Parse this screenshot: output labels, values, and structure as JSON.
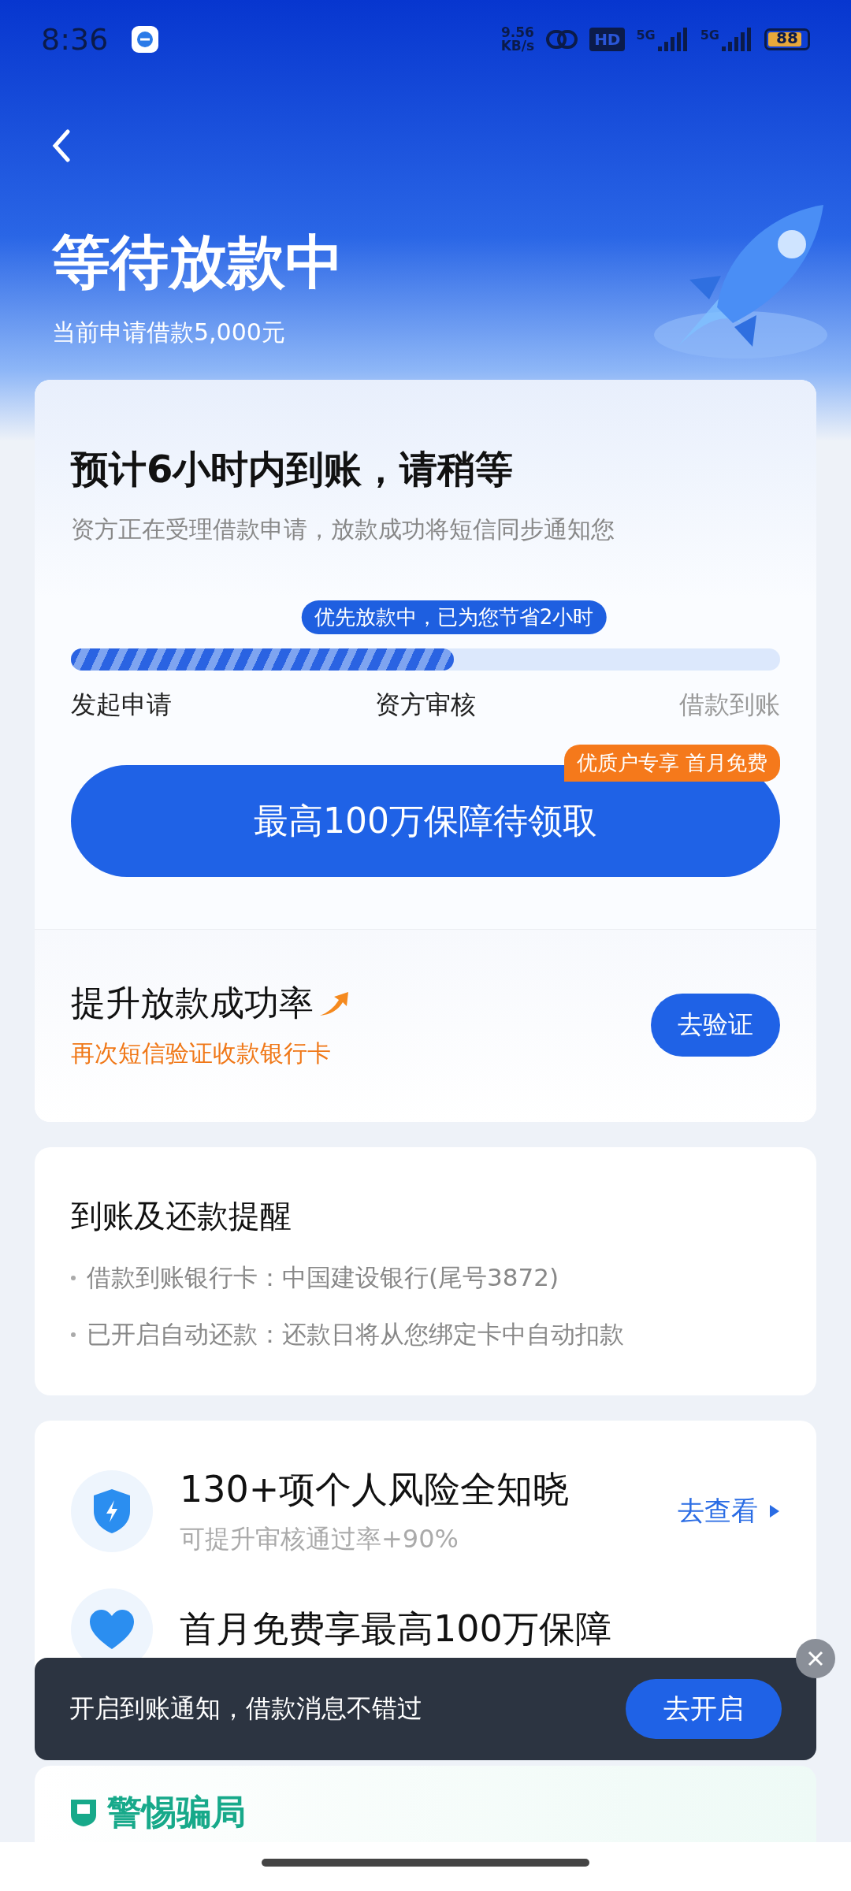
{
  "status_bar": {
    "time": "8:36",
    "net_speed": "9.56",
    "net_unit": "KB/s",
    "hd": "HD",
    "sim1": "5G",
    "sim2": "5G",
    "battery": "88"
  },
  "header": {
    "title": "等待放款中",
    "subtitle": "当前申请借款5,000元"
  },
  "status_card": {
    "heading": "预计6小时内到账，请稍等",
    "description": "资方正在受理借款申请，放款成功将短信同步通知您",
    "progress": {
      "tip": "优先放款中，已为您节省2小时",
      "level": 0.54,
      "steps": [
        {
          "label": "发起申请",
          "reached": true
        },
        {
          "label": "资方审核",
          "reached": true
        },
        {
          "label": "借款到账",
          "reached": false
        }
      ]
    },
    "guarantee_button": {
      "label": "最高100万保障待领取",
      "badge": "优质户专享 首月免费"
    },
    "boost": {
      "title": "提升放款成功率",
      "subtitle": "再次短信验证收款银行卡",
      "button": "去验证"
    }
  },
  "reminder": {
    "title": "到账及还款提醒",
    "items": [
      "借款到账银行卡：中国建设银行(尾号3872)",
      "已开启自动还款：还款日将从您绑定卡中自动扣款"
    ]
  },
  "services": [
    {
      "kind": "shield",
      "title": "130+项个人风险全知晓",
      "subtitle": "可提升审核通过率+90%",
      "action": "去查看"
    },
    {
      "kind": "heart",
      "title": "首月免费享最高100万保障"
    }
  ],
  "toast": {
    "text": "开启到账通知，借款消息不错过",
    "button": "去开启"
  },
  "scam_card": {
    "title": "警惕骗局"
  }
}
